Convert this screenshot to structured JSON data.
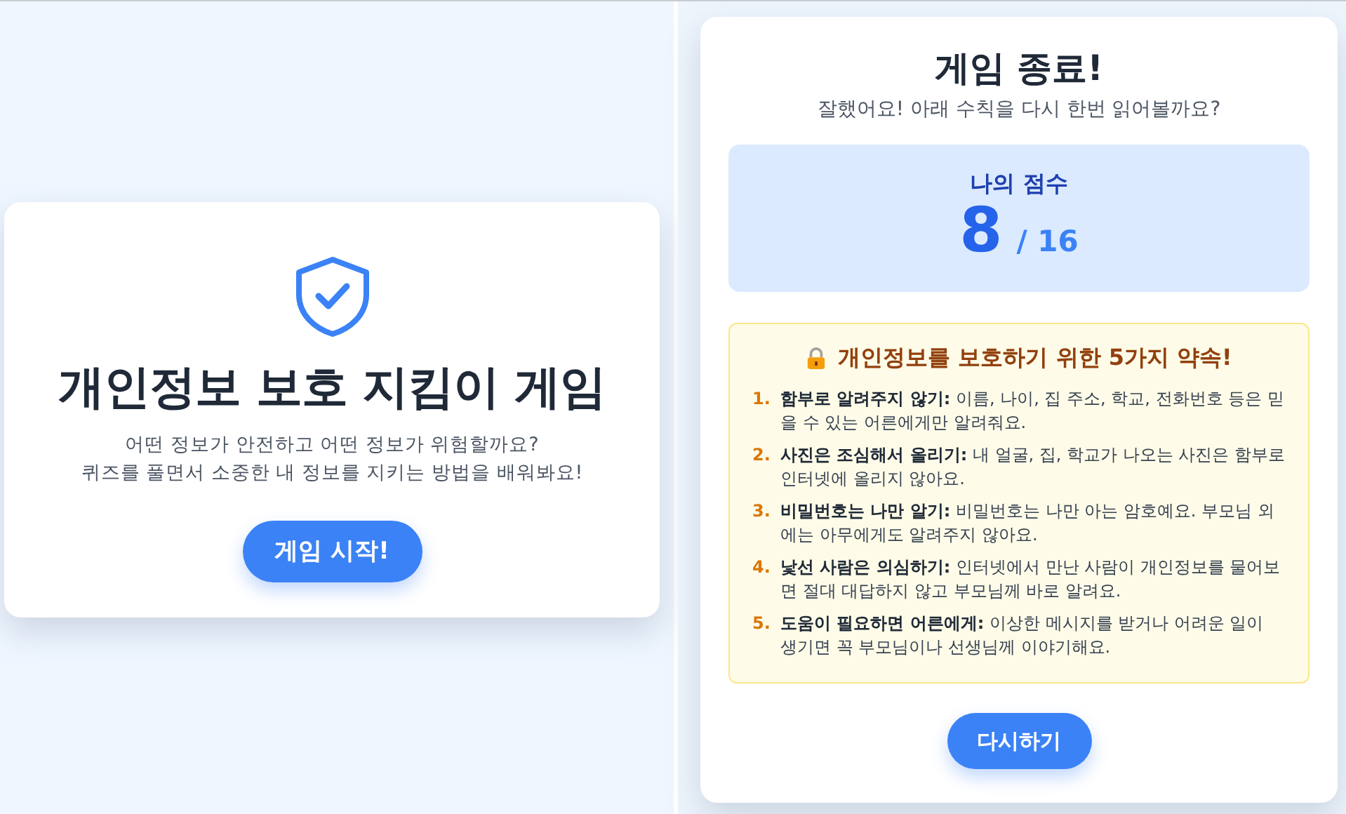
{
  "intro": {
    "title": "개인정보 보호 지킴이 게임",
    "description": [
      "어떤 정보가 안전하고 어떤 정보가 위험할까요?",
      "퀴즈를 풀면서 소중한 내 정보를 지키는 방법을 배워봐요!"
    ],
    "start_button": "게임 시작!"
  },
  "result": {
    "title": "게임 종료!",
    "subtitle": "잘했어요! 아래 수칙을 다시 한번 읽어볼까요?",
    "score": {
      "label": "나의 점수",
      "value": "8",
      "total": "/ 16"
    },
    "rules": {
      "title": "개인정보를 보호하기 위한 5가지 약속!",
      "items": [
        {
          "number": "1.",
          "text": "**함부로 알려주지 않기:** 이름, 나이, 집 주소, 학교, 전화번호 등은 믿을 수 있는 어른에게만 알려줘요."
        },
        {
          "number": "2.",
          "text": "**사진은 조심해서 올리기:** 내 얼굴, 집, 학교가 나오는 사진은 함부로 인터넷에 올리지 않아요."
        },
        {
          "number": "3.",
          "text": "**비밀번호는 나만 알기:** 비밀번호는 나만 아는 암호예요. 부모님 외에는 아무에게도 알려주지 않아요."
        },
        {
          "number": "4.",
          "text": "**낯선 사람은 의심하기:** 인터넷에서 만난 사람이 개인정보를 물어보면 절대 대답하지 않고 부모님께 바로 알려요."
        },
        {
          "number": "5.",
          "text": "**도움이 필요하면 어른에게:** 이상한 메시지를 받거나 어려운 일이 생기면 꼭 부모님이나 선생님께 이야기해요."
        }
      ]
    },
    "retry_button": "다시하기"
  }
}
